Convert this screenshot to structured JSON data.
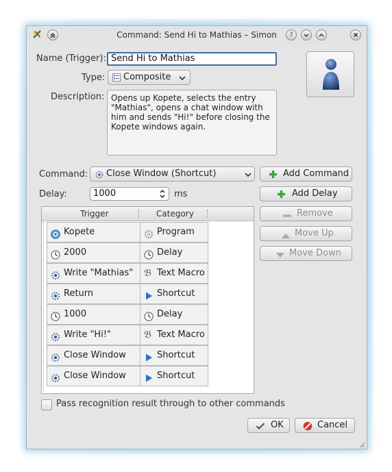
{
  "window": {
    "title": "Command: Send Hi to Mathias – Simon"
  },
  "form": {
    "name_label": "Name (Trigger):",
    "name_value": "Send Hi to Mathias",
    "type_label": "Type:",
    "type_value": "Composite",
    "description_label": "Description:",
    "description_value": "Opens up Kopete, selects the entry \"Mathias\", opens a chat window with him and sends \"Hi!\" before closing the Kopete windows again."
  },
  "command": {
    "label": "Command:",
    "selected": "Close Window (Shortcut)",
    "add_command_label": "Add Command"
  },
  "delay": {
    "label": "Delay:",
    "value": "1000",
    "unit": "ms",
    "add_delay_label": "Add Delay"
  },
  "actions": {
    "remove_label": "Remove",
    "move_up_label": "Move Up",
    "move_down_label": "Move Down"
  },
  "table": {
    "headers": [
      "Trigger",
      "Category"
    ],
    "rows": [
      {
        "trigger": "Kopete",
        "category": "Program",
        "trigger_icon": "kopete-icon",
        "category_icon": "gear-icon"
      },
      {
        "trigger": "2000",
        "category": "Delay",
        "trigger_icon": "clock-icon",
        "category_icon": "clock-icon"
      },
      {
        "trigger": "Write \"Mathias\"",
        "category": "Text Macro",
        "trigger_icon": "gear-icon",
        "category_icon": "text-macro-icon"
      },
      {
        "trigger": "Return",
        "category": "Shortcut",
        "trigger_icon": "gear-icon",
        "category_icon": "play-arrow-icon"
      },
      {
        "trigger": "1000",
        "category": "Delay",
        "trigger_icon": "clock-icon",
        "category_icon": "clock-icon"
      },
      {
        "trigger": "Write \"Hi!\"",
        "category": "Text Macro",
        "trigger_icon": "gear-icon",
        "category_icon": "text-macro-icon"
      },
      {
        "trigger": "Close Window",
        "category": "Shortcut",
        "trigger_icon": "gear-icon",
        "category_icon": "play-arrow-icon"
      },
      {
        "trigger": "Close Window",
        "category": "Shortcut",
        "trigger_icon": "gear-icon",
        "category_icon": "play-arrow-icon"
      }
    ]
  },
  "pass_through": {
    "label": "Pass recognition result through to other commands",
    "checked": false
  },
  "footer": {
    "ok_label": "OK",
    "cancel_label": "Cancel"
  },
  "colors": {
    "accent_green": "#3aa43a",
    "cancel_red": "#d23b2e",
    "shortcut_blue": "#2f6fcc",
    "focus_border": "#3b6ea5"
  }
}
